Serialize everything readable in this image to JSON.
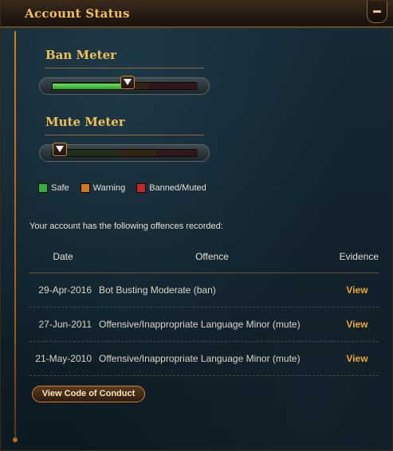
{
  "window": {
    "title": "Account Status"
  },
  "ban_meter": {
    "label": "Ban Meter",
    "level_percent": 52
  },
  "mute_meter": {
    "label": "Mute Meter",
    "level_percent": 0
  },
  "legend": [
    {
      "label": "Safe",
      "color": "#2fb43a"
    },
    {
      "label": "Warning",
      "color": "#d6741a"
    },
    {
      "label": "Banned/Muted",
      "color": "#c8262a"
    }
  ],
  "offences": {
    "intro": "Your account has the following offences recorded:",
    "headers": {
      "date": "Date",
      "offence": "Offence",
      "evidence": "Evidence"
    },
    "rows": [
      {
        "date": "29-Apr-2016",
        "offence": "Bot Busting Moderate (ban)",
        "evidence": "View"
      },
      {
        "date": "27-Jun-2011",
        "offence": "Offensive/Inappropriate Language Minor (mute)",
        "evidence": "View"
      },
      {
        "date": "21-May-2010",
        "offence": "Offensive/Inappropriate Language Minor (mute)",
        "evidence": "View"
      }
    ]
  },
  "buttons": {
    "code_of_conduct": "View Code of Conduct"
  }
}
